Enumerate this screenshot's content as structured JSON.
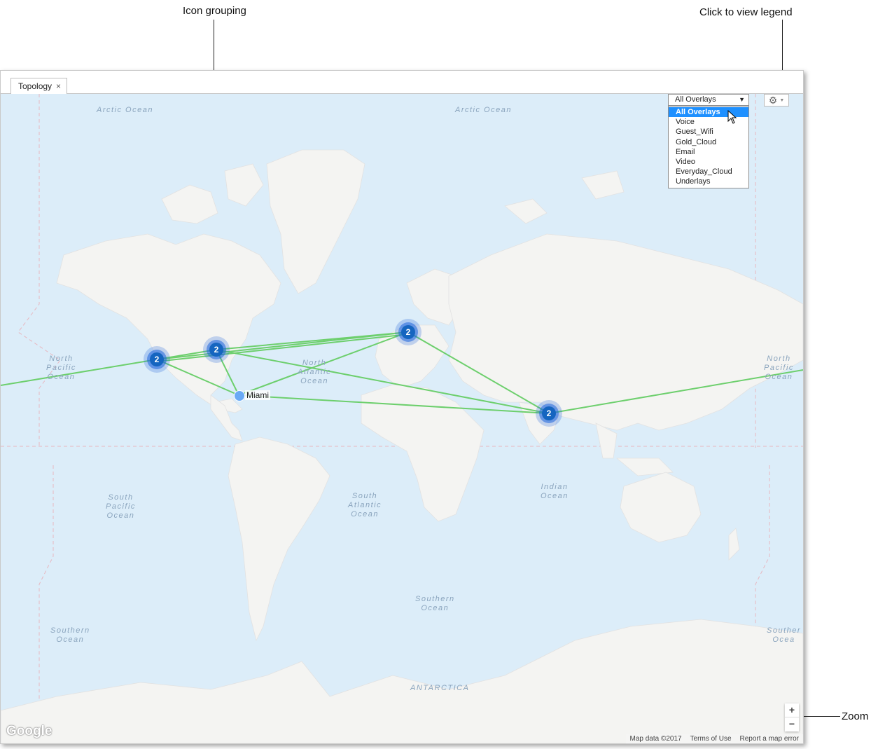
{
  "callouts": {
    "icon_grouping": "Icon grouping",
    "legend": "Click to view legend",
    "zoom": "Zoom"
  },
  "tab": {
    "label": "Topology",
    "close": "×"
  },
  "overlay_dropdown": {
    "selected": "All Overlays",
    "options": [
      "All Overlays",
      "Voice",
      "Guest_Wifi",
      "Gold_Cloud",
      "Email",
      "Video",
      "Everyday_Cloud",
      "Underlays"
    ]
  },
  "legend_button": {
    "icon": "gear-icon"
  },
  "map": {
    "ocean_labels": {
      "arctic_left": "Arctic Ocean",
      "arctic_right": "Arctic Ocean",
      "north_pacific_left": "North\nPacific\nOcean",
      "north_atlantic": "North\nAtlantic\nOcean",
      "north_pacific_right": "North\nPacific\nOcean",
      "south_pacific": "South\nPacific\nOcean",
      "south_atlantic": "South\nAtlantic\nOcean",
      "indian": "Indian\nOcean",
      "southern_center": "Southern\nOcean",
      "southern_left": "Southern\nOcean",
      "southern_right": "Souther\nOcea",
      "antarctica": "ANTARCTICA"
    },
    "clusters": [
      {
        "id": "west-us",
        "count": "2"
      },
      {
        "id": "east-us",
        "count": "2"
      },
      {
        "id": "europe",
        "count": "2"
      },
      {
        "id": "india",
        "count": "2"
      }
    ],
    "sites": [
      {
        "name": "Miami"
      }
    ],
    "link_color": "#6dcf6d",
    "cluster_color": "#1565c0"
  },
  "zoom": {
    "in": "+",
    "out": "−"
  },
  "attribution": {
    "map_data": "Map data ©2017",
    "terms": "Terms of Use",
    "report": "Report a map error"
  },
  "google_logo": "Google"
}
